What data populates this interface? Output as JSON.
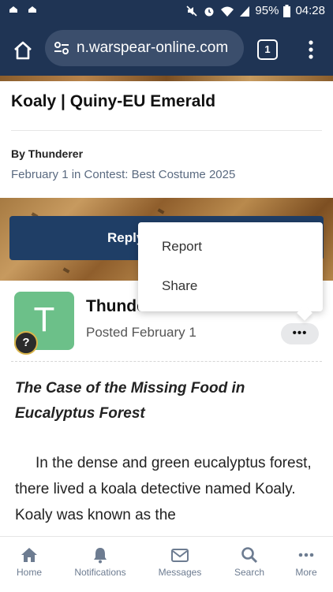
{
  "status_bar": {
    "battery": "95%",
    "time": "04:28"
  },
  "browser": {
    "url": "n.warspear-online.com",
    "tab_count": "1"
  },
  "topic": {
    "title": "Koaly | Quiny-EU Emerald",
    "author_line": "By Thunderer",
    "meta_line": "February 1 in Contest: Best Costume 2025"
  },
  "reply_button": {
    "label": "Reply"
  },
  "context_menu": {
    "items": [
      "Report",
      "Share"
    ]
  },
  "post": {
    "avatar_letter": "T",
    "badge": "?",
    "author_name": "Thunderer",
    "posted": "Posted February 1",
    "more_label": "•••",
    "title": "The Case of the Missing Food in Eucalyptus Forest",
    "body": "In the dense and green eucalyptus forest, there lived a koala detective named Koaly. Koaly was known as the"
  },
  "bottom_nav": {
    "items": [
      {
        "label": "Home",
        "icon": "home-icon"
      },
      {
        "label": "Notifications",
        "icon": "bell-icon"
      },
      {
        "label": "Messages",
        "icon": "envelope-icon"
      },
      {
        "label": "Search",
        "icon": "search-icon"
      },
      {
        "label": "More",
        "icon": "more-dots-icon"
      }
    ]
  },
  "colors": {
    "header_bg": "#1f3454",
    "reply_bg": "#1f3e66",
    "avatar_bg": "#6cc089",
    "nav_icon": "#6d7c91"
  }
}
